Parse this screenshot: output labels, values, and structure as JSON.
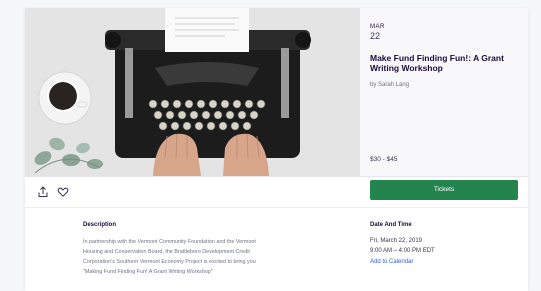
{
  "event": {
    "month": "MAR",
    "day": "22",
    "title": "Make Fund Finding Fun!: A Grant Writing Workshop",
    "organizer": "by Sarah Lang",
    "price": "$30 - $45"
  },
  "actions": {
    "tickets_label": "Tickets"
  },
  "description": {
    "heading": "Description",
    "lines": [
      "In partnership with the Vermont Community Foundation and the Vermont",
      "Housing and Conservation Board, the Brattleboro Development Credit",
      "Corporation's Southern Vermont Economy Project is excited to bring you",
      "\"Making Fund Finding Fun! A Grant Writing Workshop\""
    ]
  },
  "date_and_time": {
    "heading": "Date And Time",
    "date": "Fri, March 22, 2019",
    "time": "9:00 AM – 4:00 PM EDT",
    "add_to_calendar": "Add to Calendar"
  },
  "colors": {
    "tickets_button": "#23844e",
    "link": "#3659e3",
    "heading": "#1e0a3c"
  },
  "icons": {
    "share": "share-icon",
    "like": "heart-icon"
  }
}
